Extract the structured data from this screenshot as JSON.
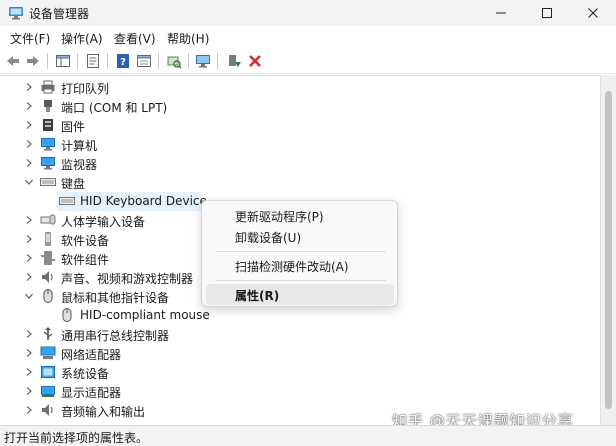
{
  "window": {
    "title": "设备管理器"
  },
  "menu": [
    "文件(F)",
    "操作(A)",
    "查看(V)",
    "帮助(H)"
  ],
  "tree": [
    {
      "label": "打印队列",
      "icon": "printer-icon",
      "state": "collapsed"
    },
    {
      "label": "端口 (COM 和 LPT)",
      "icon": "port-icon",
      "state": "collapsed"
    },
    {
      "label": "固件",
      "icon": "firmware-icon",
      "state": "collapsed"
    },
    {
      "label": "计算机",
      "icon": "computer-icon",
      "state": "collapsed"
    },
    {
      "label": "监视器",
      "icon": "monitor-icon",
      "state": "collapsed"
    },
    {
      "label": "键盘",
      "icon": "keyboard-icon",
      "state": "expanded"
    },
    {
      "label": "HID Keyboard Device",
      "icon": "keyboard-icon",
      "state": "child",
      "selected": true
    },
    {
      "label": "人体学输入设备",
      "icon": "hid-icon",
      "state": "collapsed"
    },
    {
      "label": "软件设备",
      "icon": "software-device-icon",
      "state": "collapsed"
    },
    {
      "label": "软件组件",
      "icon": "software-component-icon",
      "state": "collapsed"
    },
    {
      "label": "声音、视频和游戏控制器",
      "icon": "sound-icon",
      "state": "collapsed"
    },
    {
      "label": "鼠标和其他指针设备",
      "icon": "mouse-icon",
      "state": "expanded"
    },
    {
      "label": "HID-compliant mouse",
      "icon": "mouse-icon",
      "state": "child"
    },
    {
      "label": "通用串行总线控制器",
      "icon": "usb-icon",
      "state": "collapsed"
    },
    {
      "label": "网络适配器",
      "icon": "network-icon",
      "state": "collapsed"
    },
    {
      "label": "系统设备",
      "icon": "system-icon",
      "state": "collapsed"
    },
    {
      "label": "显示适配器",
      "icon": "display-adapter-icon",
      "state": "collapsed"
    },
    {
      "label": "音频输入和输出",
      "icon": "audio-icon",
      "state": "collapsed"
    }
  ],
  "context_menu": {
    "update_driver": "更新驱动程序(P)",
    "uninstall": "卸载设备(U)",
    "scan": "扫描检测硬件改动(A)",
    "properties": "属性(R)"
  },
  "status": "打开当前选择项的属性表。",
  "watermark": "知乎 @天天课题知识分享",
  "colors": {
    "selection": "#e5f1fb",
    "accent": "#0078d4",
    "delete_red": "#d32f2f",
    "install_green": "#2e7d32"
  }
}
